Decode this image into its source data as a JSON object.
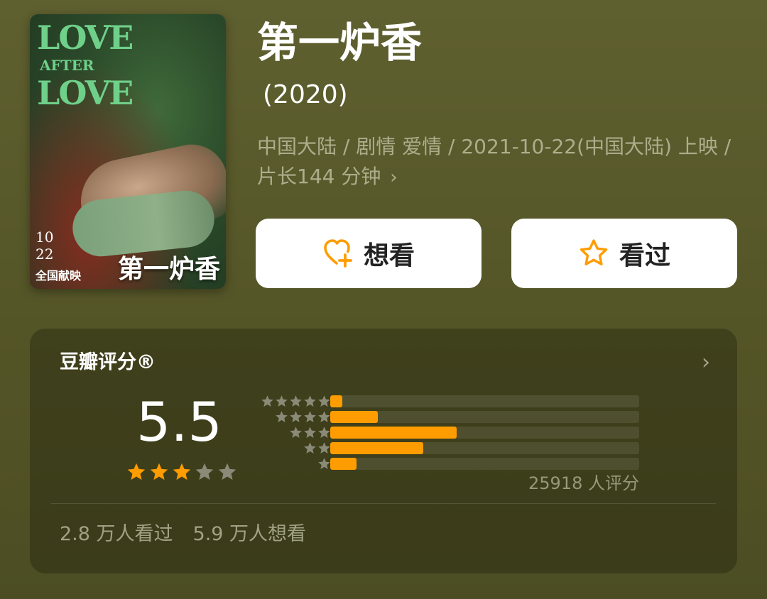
{
  "poster": {
    "title_en_line1": "LOVE",
    "title_en_line2": "AFTER",
    "title_en_line3": "LOVE",
    "title_cn": "第一炉香",
    "date_line1": "10",
    "date_line2": "22",
    "release_text": "全国献映"
  },
  "movie": {
    "title": "第一炉香",
    "year": "(2020)",
    "meta": "中国大陆 / 剧情 爱情 / 2021-10-22(中国大陆) 上映 / 片长144 分钟",
    "meta_chevron": "›"
  },
  "actions": {
    "want_label": "想看",
    "seen_label": "看过",
    "want_icon": "heart-plus-icon",
    "seen_icon": "star-outline-icon"
  },
  "rating": {
    "title": "豆瓣评分®",
    "chevron": "›",
    "score": "5.5",
    "score_stars_fraction": 0.55,
    "distribution": [
      {
        "stars": 5,
        "fraction": 0.04
      },
      {
        "stars": 4,
        "fraction": 0.155
      },
      {
        "stars": 3,
        "fraction": 0.41
      },
      {
        "stars": 2,
        "fraction": 0.3
      },
      {
        "stars": 1,
        "fraction": 0.085
      }
    ],
    "count_text": "25918 人评分",
    "seen_text": "2.8 万人看过",
    "want_text": "5.9 万人想看"
  },
  "colors": {
    "accent": "#ff9c00",
    "star_grey": "#8a8a78",
    "background": "#5a5b2c"
  }
}
